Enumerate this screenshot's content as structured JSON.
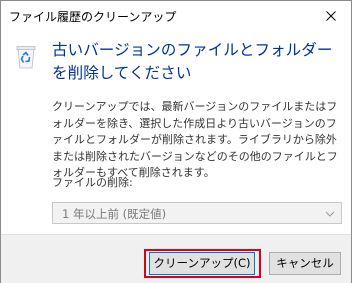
{
  "window": {
    "title": "ファイル履歴のクリーンアップ",
    "close_glyph": "✕"
  },
  "content": {
    "heading": "古いバージョンのファイルとフォルダーを削除してください",
    "description": "クリーンアップでは、最新バージョンのファイルまたはフォルダーを除き、選択した作成日より古いバージョンのファイルとフォルダーが削除されます。ライブラリから除外または削除されたバージョンなどのその他のファイルとフォルダーもすべて削除されます。",
    "delete_label": "ファイルの削除:",
    "delete_select": {
      "value": "1 年以上前 (既定値)",
      "icon": "chevron-down-icon"
    }
  },
  "buttons": {
    "cleanup_label": "クリーンアップ(C)",
    "cancel_label": "キャンセル"
  },
  "colors": {
    "heading": "#003399",
    "highlight_outline": "#e0000f",
    "default_button_border": "#0078d7",
    "footer_background": "#f0f0f0"
  }
}
